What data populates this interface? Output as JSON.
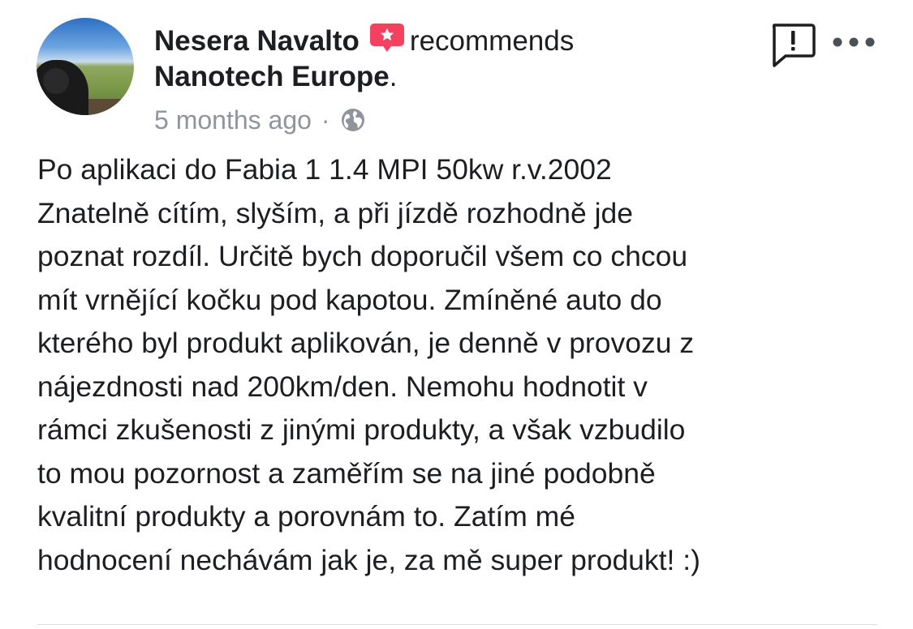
{
  "post": {
    "author": "Nesera Navalto",
    "action": "recommends",
    "page_name": "Nanotech Europe",
    "page_suffix": ".",
    "timestamp": "5 months ago",
    "separator": "·",
    "privacy_icon": "globe-icon",
    "recommend_icon": "recommend-badge-icon",
    "body_lines": [
      "Po aplikaci do Fabia 1 1.4 MPI 50kw r.v.2002",
      "Znatelně cítím, slyším, a při jízdě rozhodně jde",
      "poznat rozdíl. Určitě bych doporučil všem co chcou",
      "mít vrnějící kočku pod kapotou. Zmíněné auto do",
      "kterého byl produkt aplikován, je denně v provozu z",
      "nájezdnosti nad 200km/den. Nemohu hodnotit v",
      "rámci zkušenosti z jinými produkty, a však vzbudilo",
      "to mou pozornost a zaměřím se na jiné podobně",
      "kvalitní produkty a porovnám to. Zatím mé",
      "hodnocení nechávám jak je, za mě super produkt! :)"
    ]
  },
  "toolbar": {
    "report_icon": "report-icon",
    "more_icon": "more-options-icon"
  },
  "colors": {
    "text": "#1c1e21",
    "secondary_text": "#90949c",
    "recommend_red": "#f3425f",
    "divider": "#dadde1"
  }
}
